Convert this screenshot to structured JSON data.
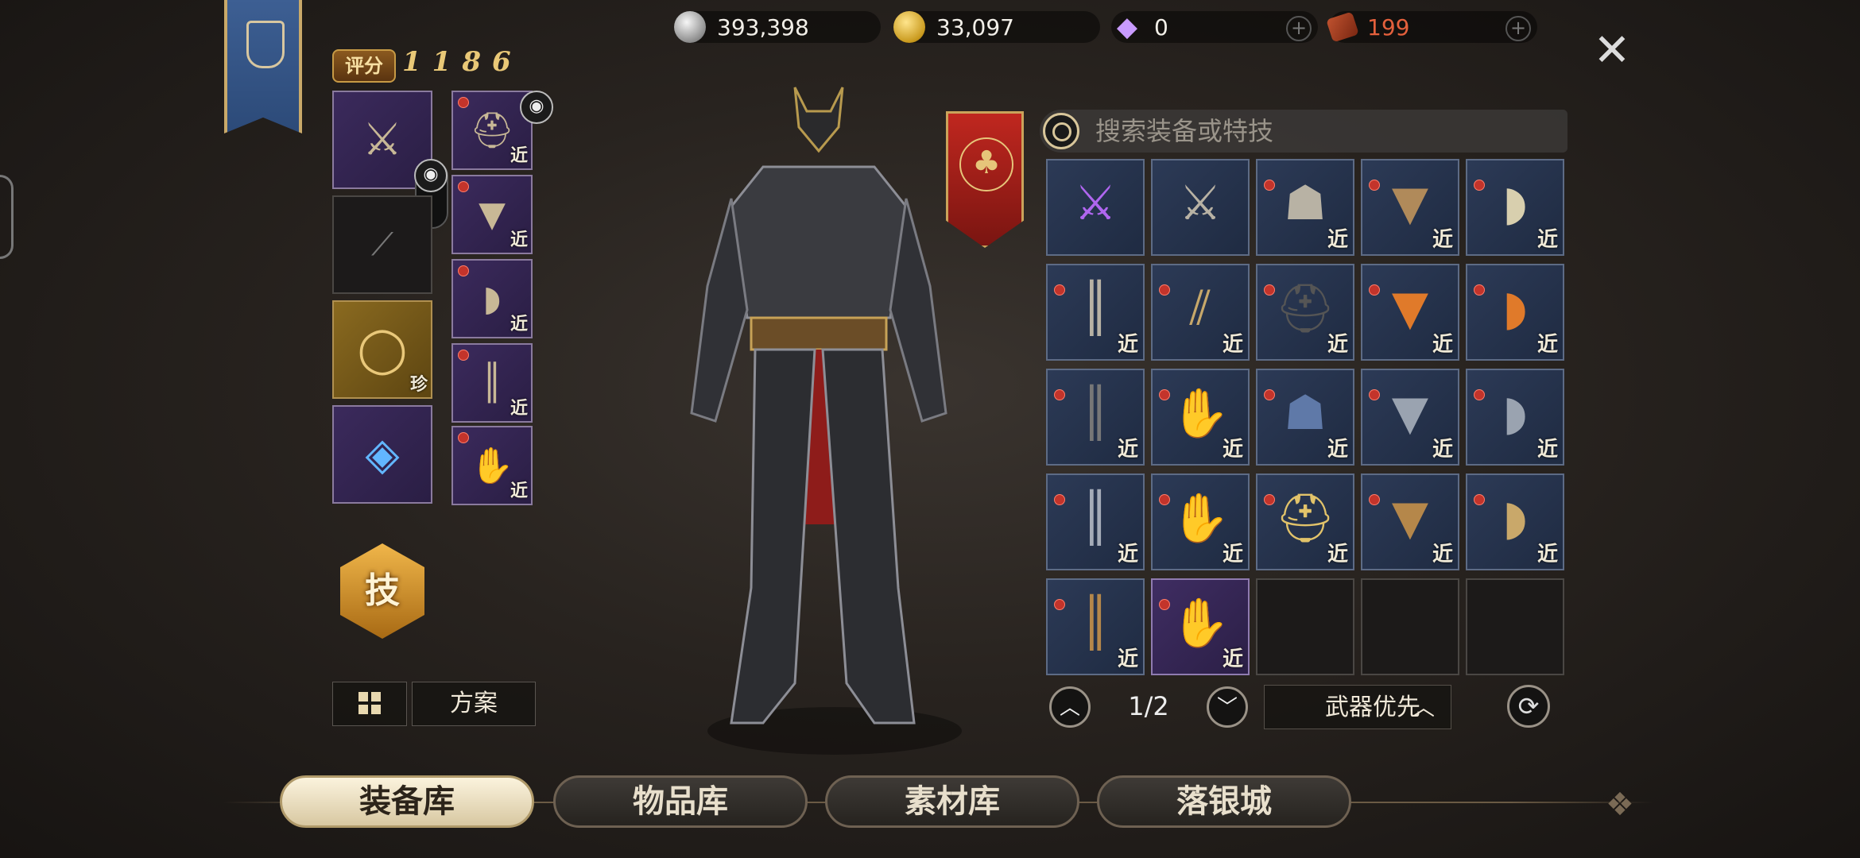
{
  "currencies": [
    {
      "name": "silver",
      "value": "393,398"
    },
    {
      "name": "gold",
      "value": "33,097"
    },
    {
      "name": "gem",
      "value": "0"
    },
    {
      "name": "ticket",
      "value": "199"
    }
  ],
  "score": {
    "label": "评分",
    "value": "1186"
  },
  "equipped": {
    "left": [
      {
        "icon": "crossed-blades",
        "tag": ""
      },
      {
        "icon": "dagger",
        "tag": ""
      },
      {
        "icon": "ring",
        "tag": "珍"
      },
      {
        "icon": "amulet",
        "tag": ""
      }
    ],
    "right": [
      {
        "icon": "helmet",
        "tag": "近"
      },
      {
        "icon": "chest-armor",
        "tag": "近"
      },
      {
        "icon": "pauldron",
        "tag": "近"
      },
      {
        "icon": "greaves",
        "tag": "近"
      },
      {
        "icon": "gauntlet",
        "tag": "近"
      }
    ]
  },
  "skill_button": "技",
  "plan_button": "方案",
  "search": {
    "placeholder": "搜索装备或特技"
  },
  "inventory": [
    {
      "icon": "crossed-swords-purple",
      "tag": "",
      "style": "blue"
    },
    {
      "icon": "crossed-swords",
      "tag": "",
      "style": "blue"
    },
    {
      "icon": "hood",
      "tag": "近",
      "style": "blue"
    },
    {
      "icon": "leather-vest",
      "tag": "近",
      "style": "blue"
    },
    {
      "icon": "pauldron",
      "tag": "近",
      "style": "blue"
    },
    {
      "icon": "boots",
      "tag": "近",
      "style": "blue"
    },
    {
      "icon": "bracer",
      "tag": "近",
      "style": "blue"
    },
    {
      "icon": "dark-helm",
      "tag": "近",
      "style": "blue"
    },
    {
      "icon": "fire-armor",
      "tag": "近",
      "style": "blue"
    },
    {
      "icon": "fire-pauldron",
      "tag": "近",
      "style": "blue"
    },
    {
      "icon": "dark-boots",
      "tag": "近",
      "style": "blue"
    },
    {
      "icon": "gauntlet",
      "tag": "近",
      "style": "blue"
    },
    {
      "icon": "blue-hood",
      "tag": "近",
      "style": "blue"
    },
    {
      "icon": "plate-armor",
      "tag": "近",
      "style": "blue"
    },
    {
      "icon": "steel-pauldron",
      "tag": "近",
      "style": "blue"
    },
    {
      "icon": "steel-boots",
      "tag": "近",
      "style": "blue"
    },
    {
      "icon": "steel-gauntlet",
      "tag": "近",
      "style": "blue"
    },
    {
      "icon": "gold-helm",
      "tag": "近",
      "style": "blue"
    },
    {
      "icon": "bronze-armor",
      "tag": "近",
      "style": "blue"
    },
    {
      "icon": "winged-pauldron",
      "tag": "近",
      "style": "blue"
    },
    {
      "icon": "bronze-greaves",
      "tag": "近",
      "style": "blue"
    },
    {
      "icon": "bronze-gauntlet",
      "tag": "近",
      "style": "purple"
    },
    {
      "icon": "",
      "tag": "",
      "style": "empty"
    },
    {
      "icon": "",
      "tag": "",
      "style": "empty"
    },
    {
      "icon": "",
      "tag": "",
      "style": "empty"
    }
  ],
  "pager": {
    "text": "1/2"
  },
  "sort": {
    "label": "武器优先"
  },
  "tabs": [
    {
      "label": "装备库",
      "active": true
    },
    {
      "label": "物品库",
      "active": false
    },
    {
      "label": "素材库",
      "active": false
    },
    {
      "label": "落银城",
      "active": false
    }
  ]
}
